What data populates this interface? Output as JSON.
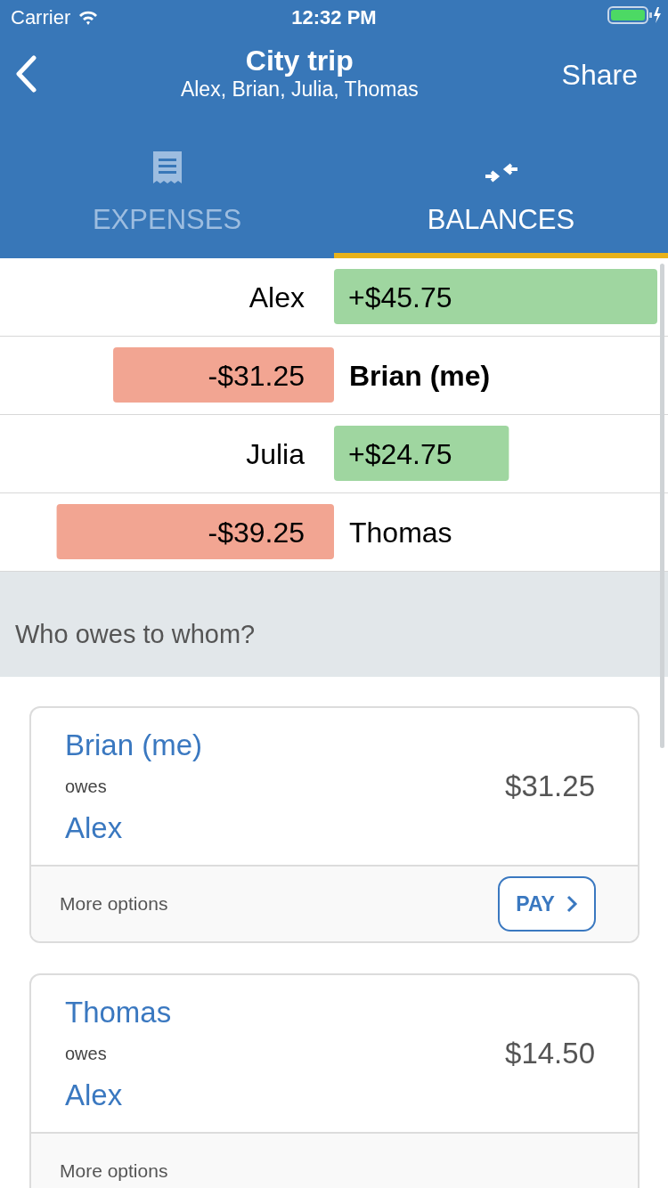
{
  "status_bar": {
    "carrier": "Carrier",
    "time": "12:32 PM"
  },
  "nav": {
    "title": "City trip",
    "subtitle": "Alex, Brian, Julia, Thomas",
    "action": "Share"
  },
  "tabs": [
    {
      "label": "EXPENSES",
      "kind": "receipt",
      "selected": false
    },
    {
      "label": "BALANCES",
      "kind": "transfer",
      "selected": true
    }
  ],
  "balances": {
    "chart_data": {
      "type": "bar",
      "orientation": "horizontal",
      "categories": [
        "Alex",
        "Brian (me)",
        "Julia",
        "Thomas"
      ],
      "values": [
        45.75,
        -31.25,
        24.75,
        -39.25
      ],
      "data_labels": true,
      "value_labels": [
        "+$45.75",
        "-$31.25",
        "+$24.75",
        "-$39.25"
      ]
    },
    "rows": [
      {
        "is_me": false
      },
      {
        "is_me": true
      },
      {
        "is_me": false
      },
      {
        "is_me": false
      }
    ]
  },
  "section_header": "Who owes to whom?",
  "debts": [
    {
      "from": "Brian (me)",
      "verb": "owes",
      "to": "Alex",
      "amount": "$31.25",
      "more": "More options",
      "pay": "PAY"
    },
    {
      "from": "Thomas",
      "verb": "owes",
      "to": "Alex",
      "amount": "$14.50",
      "more": "More options"
    }
  ]
}
